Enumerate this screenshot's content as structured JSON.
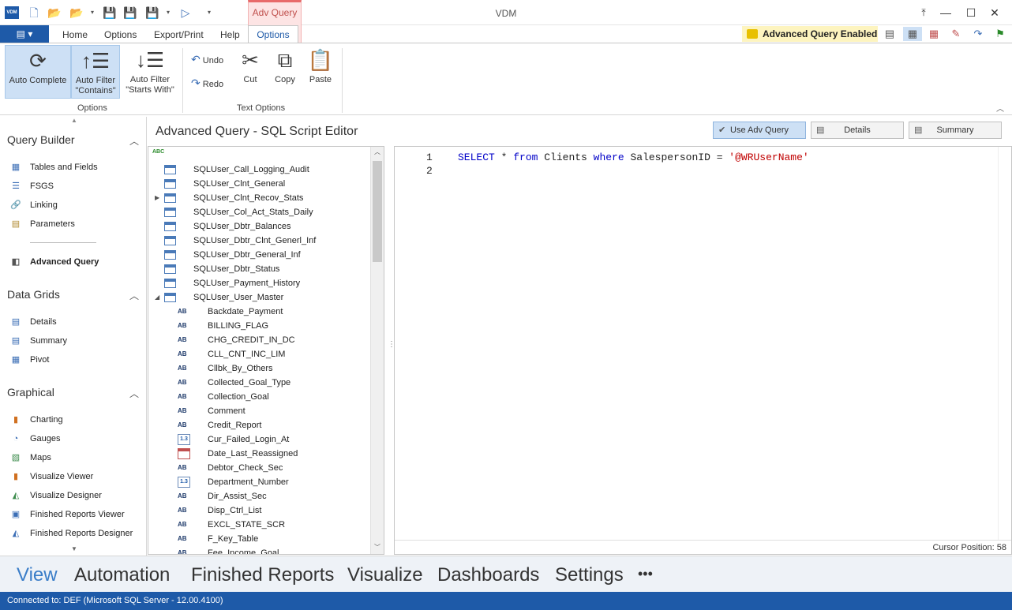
{
  "app": {
    "logo_text": "VDM",
    "title": "VDM"
  },
  "contextual_tab": {
    "label": "Adv Query"
  },
  "ribbon_tabs": [
    {
      "label": "Home"
    },
    {
      "label": "Options"
    },
    {
      "label": "Export/Print"
    },
    {
      "label": "Help"
    },
    {
      "label": "Options"
    }
  ],
  "status_badge": "Advanced Query Enabled",
  "ribbon": {
    "options_group": {
      "label": "Options",
      "auto_complete": "Auto Complete",
      "auto_filter_contains_l1": "Auto Filter",
      "auto_filter_contains_l2": "\"Contains\"",
      "auto_filter_starts_l1": "Auto Filter",
      "auto_filter_starts_l2": "\"Starts With\""
    },
    "text_group": {
      "label": "Text Options",
      "undo": "Undo",
      "redo": "Redo",
      "cut": "Cut",
      "copy": "Copy",
      "paste": "Paste"
    }
  },
  "nav": {
    "query_builder": {
      "title": "Query Builder",
      "items": [
        "Tables and Fields",
        "FSGS",
        "Linking",
        "Parameters"
      ],
      "active": "Advanced Query"
    },
    "data_grids": {
      "title": "Data Grids",
      "items": [
        "Details",
        "Summary",
        "Pivot"
      ]
    },
    "graphical": {
      "title": "Graphical",
      "items": [
        "Charting",
        "Gauges",
        "Maps",
        "Visualize Viewer",
        "Visualize Designer",
        "Finished Reports Viewer",
        "Finished Reports Designer"
      ]
    }
  },
  "editor": {
    "title": "Advanced Query - SQL Script Editor",
    "use_adv_query": "Use Adv Query",
    "details": "Details",
    "summary": "Summary",
    "line_numbers": [
      "1",
      "2"
    ],
    "code": {
      "kw1": "SELECT",
      "t1": " * ",
      "kw2": "from",
      "t2": " Clients ",
      "kw3": "where",
      "t3": " SalespersonID = ",
      "str": "'@WRUserName'"
    },
    "cursor_position": "Cursor Position: 58"
  },
  "tree": {
    "header_icon": "abc-sort-icon",
    "tables": [
      "SQLUser_Call_Logging_Audit",
      "SQLUser_Clnt_General",
      "SQLUser_Clnt_Recov_Stats",
      "SQLUser_Col_Act_Stats_Daily",
      "SQLUser_Dbtr_Balances",
      "SQLUser_Dbtr_Clnt_Generl_Inf",
      "SQLUser_Dbtr_General_Inf",
      "SQLUser_Dbtr_Status",
      "SQLUser_Payment_History",
      "SQLUser_User_Master"
    ],
    "fields": [
      {
        "type": "AB",
        "name": "Backdate_Payment"
      },
      {
        "type": "AB",
        "name": "BILLING_FLAG"
      },
      {
        "type": "AB",
        "name": "CHG_CREDIT_IN_DC"
      },
      {
        "type": "AB",
        "name": "CLL_CNT_INC_LIM"
      },
      {
        "type": "AB",
        "name": "Cllbk_By_Others"
      },
      {
        "type": "AB",
        "name": "Collected_Goal_Type"
      },
      {
        "type": "AB",
        "name": "Collection_Goal"
      },
      {
        "type": "AB",
        "name": "Comment"
      },
      {
        "type": "AB",
        "name": "Credit_Report"
      },
      {
        "type": "1.3",
        "name": "Cur_Failed_Login_At"
      },
      {
        "type": "date",
        "name": "Date_Last_Reassigned"
      },
      {
        "type": "AB",
        "name": "Debtor_Check_Sec"
      },
      {
        "type": "1.3",
        "name": "Department_Number"
      },
      {
        "type": "AB",
        "name": "Dir_Assist_Sec"
      },
      {
        "type": "AB",
        "name": "Disp_Ctrl_List"
      },
      {
        "type": "AB",
        "name": "EXCL_STATE_SCR"
      },
      {
        "type": "AB",
        "name": "F_Key_Table"
      },
      {
        "type": "AB",
        "name": "Fee_Income_Goal"
      }
    ]
  },
  "bottom_nav": [
    "View",
    "Automation",
    "Finished Reports",
    "Visualize",
    "Dashboards",
    "Settings",
    "•••"
  ],
  "status_bar": "Connected to: DEF (Microsoft SQL Server - 12.00.4100)",
  "colors": {
    "accent": "#1e5aa8",
    "context_tab": "#c0504d",
    "keyword": "#0000c8",
    "string": "#c00000"
  }
}
